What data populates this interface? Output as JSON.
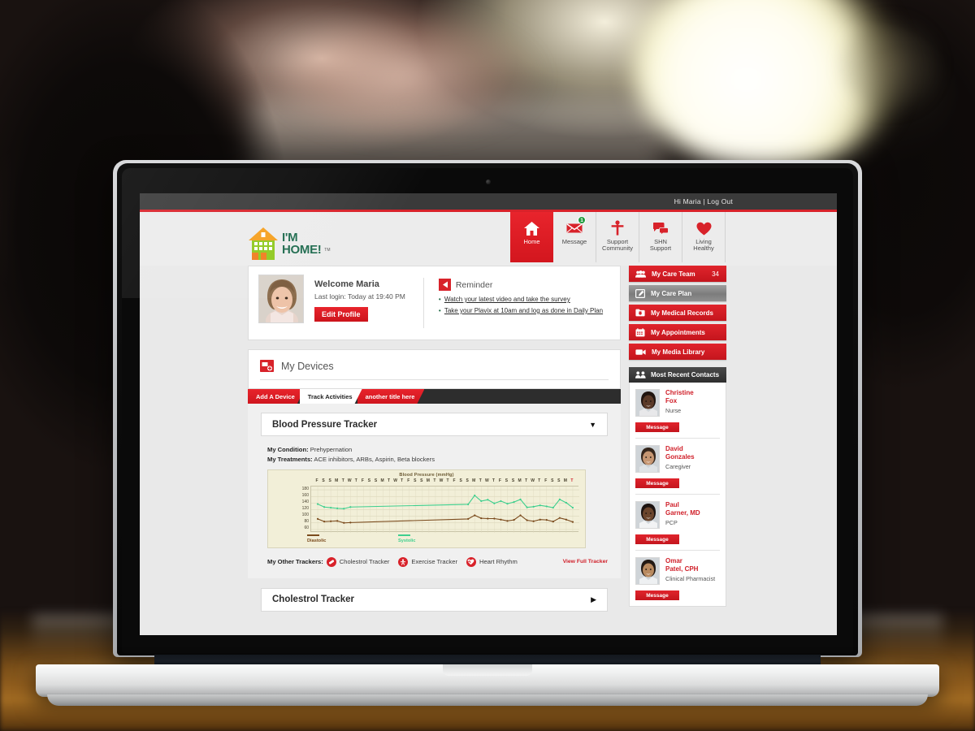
{
  "topbar": {
    "greeting": "Hi Maria | Log Out"
  },
  "logo": {
    "line1": "I'M",
    "line2": "HOME!",
    "tm": "TM"
  },
  "nav": [
    {
      "label": "Home",
      "icon": "house-icon",
      "active": true,
      "badge": ""
    },
    {
      "label": "Message",
      "icon": "envelope-icon",
      "active": false,
      "badge": "1"
    },
    {
      "label": "Support\nCommunity",
      "label_l1": "Support",
      "label_l2": "Community",
      "icon": "person-icon",
      "active": false,
      "badge": ""
    },
    {
      "label": "SHN\nSupport",
      "label_l1": "SHN",
      "label_l2": "Support",
      "icon": "chat-bubbles-icon",
      "active": false,
      "badge": ""
    },
    {
      "label": "Living\nHealthy",
      "label_l1": "Living",
      "label_l2": "Healthy",
      "icon": "heart-icon",
      "active": false,
      "badge": ""
    }
  ],
  "welcome": {
    "name": "Welcome Maria",
    "last_login": "Last login: Today at 19:40 PM",
    "edit_profile": "Edit Profile"
  },
  "reminder": {
    "title": "Reminder",
    "items": [
      "Watch your latest video and take the survey",
      "Take your Plavix at 10am and log as done in Daily Plan"
    ]
  },
  "devices": {
    "title": "My Devices",
    "tabs": [
      {
        "label": "Add A Device",
        "active": false
      },
      {
        "label": "Track Activities",
        "active": true
      },
      {
        "label": "another title here",
        "active": false
      }
    ],
    "tracker_open": {
      "title": "Blood Pressure Tracker",
      "arrow": "▼"
    },
    "tracker_closed": {
      "title": "Cholestrol Tracker",
      "arrow": "▶"
    },
    "condition_label": "My Condition:",
    "condition_value": "Prehypernation",
    "treatments_label": "My Treatments:",
    "treatments_value": "ACE inhibitors, ARBs, Aspirin, Beta blockers",
    "other_trackers_label": "My Other Trackers:",
    "other_trackers": [
      {
        "label": "Cholestrol Tracker",
        "icon": "pill-icon"
      },
      {
        "label": "Exercise Tracker",
        "icon": "runner-icon"
      },
      {
        "label": "Heart Rhythm",
        "icon": "heartbeat-icon"
      }
    ],
    "view_full": "View Full Tracker"
  },
  "chart_data": {
    "type": "line",
    "title": "Blood Pressure (mmHg)",
    "xlabel": "",
    "ylabel": "",
    "ylim": [
      50,
      190
    ],
    "yticks": [
      60,
      80,
      100,
      120,
      140,
      160,
      180
    ],
    "grid": true,
    "legend_position": "bottom",
    "x_tick_labels": [
      "F",
      "S",
      "S",
      "M",
      "T",
      "W",
      "T",
      "F",
      "S",
      "S",
      "M",
      "T",
      "W",
      "T",
      "F",
      "S",
      "S",
      "M",
      "T",
      "W",
      "T",
      "F",
      "S",
      "S",
      "M",
      "T",
      "W",
      "T",
      "F",
      "S",
      "S",
      "M",
      "T",
      "W",
      "T",
      "F",
      "S",
      "S",
      "M",
      "T"
    ],
    "x_last_highlight_color": "#d0202a",
    "series": [
      {
        "name": "Systolic",
        "color": "#3ecf8e",
        "values": [
          137,
          128,
          126,
          124,
          123,
          128,
          null,
          null,
          null,
          null,
          null,
          null,
          null,
          null,
          null,
          null,
          null,
          null,
          null,
          null,
          null,
          null,
          null,
          136,
          163,
          146,
          150,
          139,
          146,
          138,
          143,
          151,
          127,
          129,
          133,
          130,
          126,
          151,
          141,
          126
        ]
      },
      {
        "name": "Diastolic",
        "color": "#7a4a1c",
        "values": [
          92,
          84,
          85,
          86,
          80,
          81,
          null,
          null,
          null,
          null,
          null,
          null,
          null,
          null,
          null,
          null,
          null,
          null,
          null,
          null,
          null,
          null,
          null,
          92,
          103,
          94,
          93,
          93,
          90,
          86,
          89,
          103,
          88,
          85,
          90,
          89,
          84,
          95,
          90,
          83
        ]
      }
    ]
  },
  "sidebar": {
    "items": [
      {
        "label": "My Care Team",
        "icon": "people-icon",
        "count": "34",
        "style": "red"
      },
      {
        "label": "My Care Plan",
        "icon": "edit-note-icon",
        "count": "",
        "style": "grey"
      },
      {
        "label": "My Medical Records",
        "icon": "folder-icon",
        "count": "",
        "style": "red"
      },
      {
        "label": "My Appointments",
        "icon": "calendar-icon",
        "count": "",
        "style": "red"
      },
      {
        "label": "My Media Library",
        "icon": "video-camera-icon",
        "count": "",
        "style": "red"
      }
    ],
    "contacts_header": "Most Recent Contacts",
    "contacts": [
      {
        "first": "Christine",
        "last": "Fox",
        "role": "Nurse",
        "button": "Message",
        "skin": "#5a3a28",
        "hair": "#201510",
        "shirt": "#e8e8ea"
      },
      {
        "first": "David",
        "last": "Gonzales",
        "role": "Caregiver",
        "button": "Message",
        "skin": "#c69672",
        "hair": "#35261c",
        "shirt": "#dfe3e6"
      },
      {
        "first": "Paul",
        "last": "Garner, MD",
        "role": "PCP",
        "button": "Message",
        "skin": "#6b452c",
        "hair": "#1c1310",
        "shirt": "#f2f3f4"
      },
      {
        "first": "Omar",
        "last": "Patel, CPH",
        "role": "Clinical Pharmacist",
        "button": "Message",
        "skin": "#b98a5f",
        "hair": "#241a14",
        "shirt": "#eef0f2"
      }
    ]
  },
  "colors": {
    "brand_red": "#d8222a",
    "dark_bar": "#3a3a3a",
    "page_bg": "#e9e9e9",
    "chart_bg": "#f2efd8",
    "systolic": "#3ecf8e",
    "diastolic": "#7a4a1c",
    "badge_green": "#1f9b3e",
    "logo_green": "#1e6b4e"
  }
}
